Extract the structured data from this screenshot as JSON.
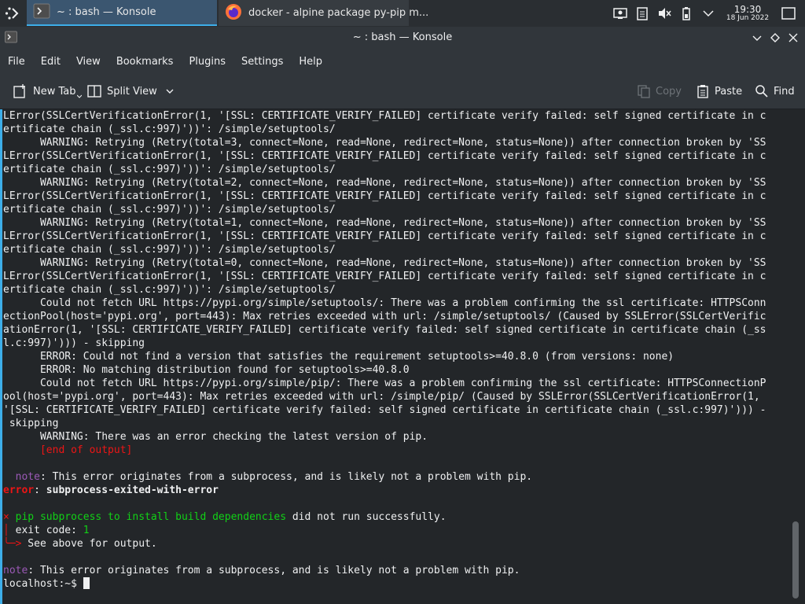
{
  "panel": {
    "tasks": [
      {
        "label": "~ : bash — Konsole",
        "icon": "konsole-icon",
        "active": true
      },
      {
        "label": "docker - alpine package py-pip m...",
        "icon": "firefox-icon",
        "active": false
      }
    ],
    "tray_icons": [
      "screen-icon",
      "clipboard-icon",
      "speaker-muted-icon",
      "battery-icon",
      "chevron-down-icon"
    ],
    "clock": {
      "time": "19:30",
      "date": "18 Jun 2022"
    }
  },
  "window": {
    "title": "~ : bash — Konsole",
    "buttons": [
      "minimize",
      "maximize",
      "close"
    ]
  },
  "menubar": [
    "File",
    "Edit",
    "View",
    "Bookmarks",
    "Plugins",
    "Settings",
    "Help"
  ],
  "toolbar": {
    "new_tab": "New Tab",
    "split_view": "Split View",
    "copy": "Copy",
    "paste": "Paste",
    "find": "Find"
  },
  "terminal": {
    "prompt": "localhost:~$ ",
    "lines": [
      {
        "segments": [
          {
            "text": "LError(SSLCertVerificationError(1, '[SSL: CERTIFICATE_VERIFY_FAILED] certificate verify failed: self signed certificate in c"
          }
        ]
      },
      {
        "segments": [
          {
            "text": "ertificate chain (_ssl.c:997)'))': /simple/setuptools/"
          }
        ]
      },
      {
        "segments": [
          {
            "text": "      WARNING: Retrying (Retry(total=3, connect=None, read=None, redirect=None, status=None)) after connection broken by 'SS"
          }
        ]
      },
      {
        "segments": [
          {
            "text": "LError(SSLCertVerificationError(1, '[SSL: CERTIFICATE_VERIFY_FAILED] certificate verify failed: self signed certificate in c"
          }
        ]
      },
      {
        "segments": [
          {
            "text": "ertificate chain (_ssl.c:997)'))': /simple/setuptools/"
          }
        ]
      },
      {
        "segments": [
          {
            "text": "      WARNING: Retrying (Retry(total=2, connect=None, read=None, redirect=None, status=None)) after connection broken by 'SS"
          }
        ]
      },
      {
        "segments": [
          {
            "text": "LError(SSLCertVerificationError(1, '[SSL: CERTIFICATE_VERIFY_FAILED] certificate verify failed: self signed certificate in c"
          }
        ]
      },
      {
        "segments": [
          {
            "text": "ertificate chain (_ssl.c:997)'))': /simple/setuptools/"
          }
        ]
      },
      {
        "segments": [
          {
            "text": "      WARNING: Retrying (Retry(total=1, connect=None, read=None, redirect=None, status=None)) after connection broken by 'SS"
          }
        ]
      },
      {
        "segments": [
          {
            "text": "LError(SSLCertVerificationError(1, '[SSL: CERTIFICATE_VERIFY_FAILED] certificate verify failed: self signed certificate in c"
          }
        ]
      },
      {
        "segments": [
          {
            "text": "ertificate chain (_ssl.c:997)'))': /simple/setuptools/"
          }
        ]
      },
      {
        "segments": [
          {
            "text": "      WARNING: Retrying (Retry(total=0, connect=None, read=None, redirect=None, status=None)) after connection broken by 'SS"
          }
        ]
      },
      {
        "segments": [
          {
            "text": "LError(SSLCertVerificationError(1, '[SSL: CERTIFICATE_VERIFY_FAILED] certificate verify failed: self signed certificate in c"
          }
        ]
      },
      {
        "segments": [
          {
            "text": "ertificate chain (_ssl.c:997)'))': /simple/setuptools/"
          }
        ]
      },
      {
        "segments": [
          {
            "text": "      Could not fetch URL https://pypi.org/simple/setuptools/: There was a problem confirming the ssl certificate: HTTPSConn"
          }
        ]
      },
      {
        "segments": [
          {
            "text": "ectionPool(host='pypi.org', port=443): Max retries exceeded with url: /simple/setuptools/ (Caused by SSLError(SSLCertVerific"
          }
        ]
      },
      {
        "segments": [
          {
            "text": "ationError(1, '[SSL: CERTIFICATE_VERIFY_FAILED] certificate verify failed: self signed certificate in certificate chain (_ss"
          }
        ]
      },
      {
        "segments": [
          {
            "text": "l.c:997)'))) - skipping"
          }
        ]
      },
      {
        "segments": [
          {
            "text": "      ERROR: Could not find a version that satisfies the requirement setuptools>=40.8.0 (from versions: none)"
          }
        ]
      },
      {
        "segments": [
          {
            "text": "      ERROR: No matching distribution found for setuptools>=40.8.0"
          }
        ]
      },
      {
        "segments": [
          {
            "text": "      Could not fetch URL https://pypi.org/simple/pip/: There was a problem confirming the ssl certificate: HTTPSConnectionP"
          }
        ]
      },
      {
        "segments": [
          {
            "text": "ool(host='pypi.org', port=443): Max retries exceeded with url: /simple/pip/ (Caused by SSLError(SSLCertVerificationError(1,"
          }
        ]
      },
      {
        "segments": [
          {
            "text": "'[SSL: CERTIFICATE_VERIFY_FAILED] certificate verify failed: self signed certificate in certificate chain (_ssl.c:997)'))) -"
          }
        ]
      },
      {
        "segments": [
          {
            "text": " skipping"
          }
        ]
      },
      {
        "segments": [
          {
            "text": "      WARNING: There was an error checking the latest version of pip."
          }
        ]
      },
      {
        "segments": [
          {
            "text": "      "
          },
          {
            "text": "[end of output]",
            "style": "red"
          }
        ]
      },
      {
        "segments": [
          {
            "text": ""
          }
        ]
      },
      {
        "segments": [
          {
            "text": "  "
          },
          {
            "text": "note",
            "style": "magenta"
          },
          {
            "text": ": This error originates from a subprocess, and is likely not a problem with pip."
          }
        ]
      },
      {
        "segments": [
          {
            "text": "error",
            "style": "redbold"
          },
          {
            "text": ": "
          },
          {
            "text": "subprocess-exited-with-error",
            "style": "bold"
          }
        ]
      },
      {
        "segments": [
          {
            "text": ""
          }
        ]
      },
      {
        "segments": [
          {
            "text": "×",
            "style": "red"
          },
          {
            "text": " pip subprocess to install build dependencies",
            "style": "green"
          },
          {
            "text": " did not run successfully."
          }
        ]
      },
      {
        "segments": [
          {
            "text": "│",
            "style": "red"
          },
          {
            "text": " exit code: "
          },
          {
            "text": "1",
            "style": "green"
          }
        ]
      },
      {
        "segments": [
          {
            "text": "╰─>",
            "style": "red"
          },
          {
            "text": " See above for output."
          }
        ]
      },
      {
        "segments": [
          {
            "text": ""
          }
        ]
      },
      {
        "segments": [
          {
            "text": "note",
            "style": "magenta"
          },
          {
            "text": ": This error originates from a subprocess, and is likely not a problem with pip."
          }
        ]
      }
    ]
  }
}
